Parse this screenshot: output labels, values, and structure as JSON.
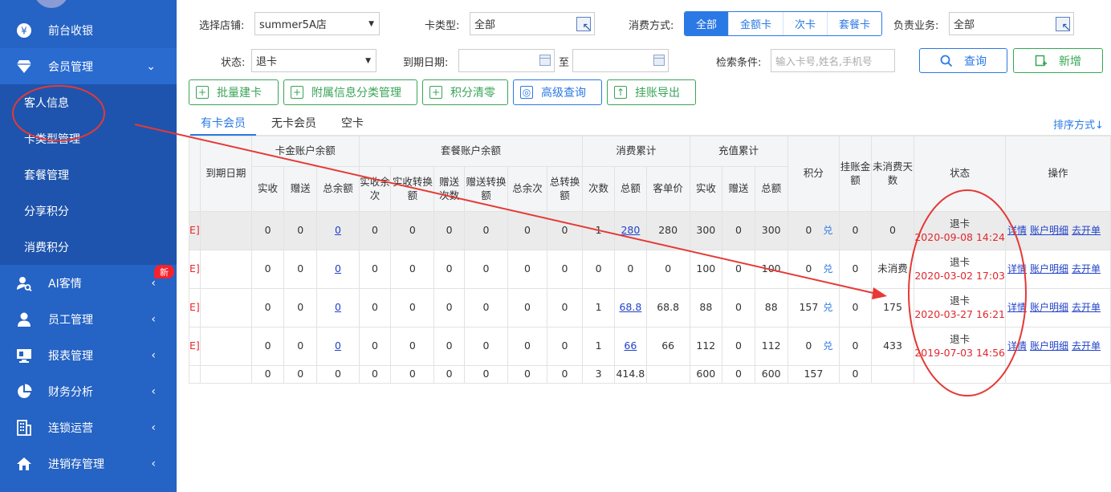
{
  "sidebar": {
    "items": [
      {
        "label": "前台收银",
        "icon": "yen-icon"
      },
      {
        "label": "会员管理",
        "icon": "diamond-icon",
        "arrow": "⌄"
      },
      {
        "label": "AI客情",
        "icon": "user-search-icon",
        "arrow": "‹",
        "badge": "新"
      },
      {
        "label": "员工管理",
        "icon": "person-icon",
        "arrow": "‹"
      },
      {
        "label": "报表管理",
        "icon": "monitor-icon",
        "arrow": "‹"
      },
      {
        "label": "财务分析",
        "icon": "pie-chart-icon",
        "arrow": "‹"
      },
      {
        "label": "连锁运营",
        "icon": "building-icon",
        "arrow": "‹"
      },
      {
        "label": "进销存管理",
        "icon": "house-icon",
        "arrow": "‹"
      }
    ],
    "sub_items": [
      "客人信息",
      "卡类型管理",
      "套餐管理",
      "分享积分",
      "消费积分"
    ]
  },
  "filters": {
    "store_label": "选择店铺:",
    "store_value": "summer5A店",
    "card_type_label": "卡类型:",
    "card_type_value": "全部",
    "consume_label": "消费方式:",
    "consume_options": [
      "全部",
      "金额卡",
      "次卡",
      "套餐卡"
    ],
    "business_label": "负责业务:",
    "business_value": "全部",
    "status_label": "状态:",
    "status_value": "退卡",
    "expire_label": "到期日期:",
    "to_label": "至",
    "search_label": "检索条件:",
    "search_placeholder": "输入卡号,姓名,手机号",
    "query_button": "查询",
    "add_button": "新增"
  },
  "toolbar": [
    "批量建卡",
    "附属信息分类管理",
    "积分清零",
    "高级查询",
    "挂账导出"
  ],
  "tabs": [
    "有卡会员",
    "无卡会员",
    "空卡"
  ],
  "sort_label": "排序方式↓",
  "table": {
    "headers": {
      "expire": "到期日期",
      "card_balance": "卡金账户余额",
      "package_balance": "套餐账户余额",
      "consume_total": "消费累计",
      "recharge_total": "充值累计",
      "points": "积分",
      "credit": "挂账金额",
      "unconsumed_days": "未消费天数",
      "status": "状态",
      "ops": "操作",
      "card_sub": [
        "实收",
        "赠送",
        "总余额"
      ],
      "package_sub": [
        "实收余次",
        "实收转换额",
        "赠送次数",
        "赠送转换额",
        "总余次",
        "总转换额"
      ],
      "consume_sub": [
        "次数",
        "总额",
        "客单价"
      ],
      "recharge_sub": [
        "实收",
        "赠送",
        "总额"
      ]
    },
    "rows": [
      {
        "frag": "E]",
        "card": [
          "0",
          "0",
          "0"
        ],
        "pkg": [
          "0",
          "0",
          "0",
          "0",
          "0",
          "0"
        ],
        "consume": [
          "1",
          "280",
          "280"
        ],
        "recharge": [
          "300",
          "0",
          "300"
        ],
        "points": "0",
        "points_link": "兑",
        "credit": "0",
        "days": "0",
        "status": "退卡",
        "time": "2020-09-08 14:24",
        "ops": [
          "详情",
          "账户明细",
          "去开单"
        ]
      },
      {
        "frag": "E]",
        "card": [
          "0",
          "0",
          "0"
        ],
        "pkg": [
          "0",
          "0",
          "0",
          "0",
          "0",
          "0"
        ],
        "consume": [
          "0",
          "0",
          "0"
        ],
        "recharge": [
          "100",
          "0",
          "100"
        ],
        "points": "0",
        "points_link": "兑",
        "credit": "0",
        "days": "未消费",
        "status": "退卡",
        "time": "2020-03-02 17:03",
        "ops": [
          "详情",
          "账户明细",
          "去开单"
        ]
      },
      {
        "frag": "E]",
        "card": [
          "0",
          "0",
          "0"
        ],
        "pkg": [
          "0",
          "0",
          "0",
          "0",
          "0",
          "0"
        ],
        "consume": [
          "1",
          "68.8",
          "68.8"
        ],
        "recharge": [
          "88",
          "0",
          "88"
        ],
        "points": "157",
        "points_link": "兑",
        "credit": "0",
        "days": "175",
        "status": "退卡",
        "time": "2020-03-27 16:21",
        "ops": [
          "详情",
          "账户明细",
          "去开单"
        ]
      },
      {
        "frag": "E]",
        "card": [
          "0",
          "0",
          "0"
        ],
        "pkg": [
          "0",
          "0",
          "0",
          "0",
          "0",
          "0"
        ],
        "consume": [
          "1",
          "66",
          "66"
        ],
        "recharge": [
          "112",
          "0",
          "112"
        ],
        "points": "0",
        "points_link": "兑",
        "credit": "0",
        "days": "433",
        "status": "退卡",
        "time": "2019-07-03 14:56",
        "ops": [
          "详情",
          "账户明细",
          "去开单"
        ]
      }
    ],
    "totals": {
      "card": [
        "0",
        "0",
        "0"
      ],
      "pkg": [
        "0",
        "0",
        "0",
        "0",
        "0",
        "0"
      ],
      "consume": [
        "3",
        "414.8",
        ""
      ],
      "recharge": [
        "600",
        "0",
        "600"
      ],
      "points": "157",
      "credit": "0"
    }
  },
  "colors": {
    "sidebar": "#2563c4",
    "accent": "#2b79e4",
    "green": "#34a853",
    "annotation": "#e53935"
  }
}
